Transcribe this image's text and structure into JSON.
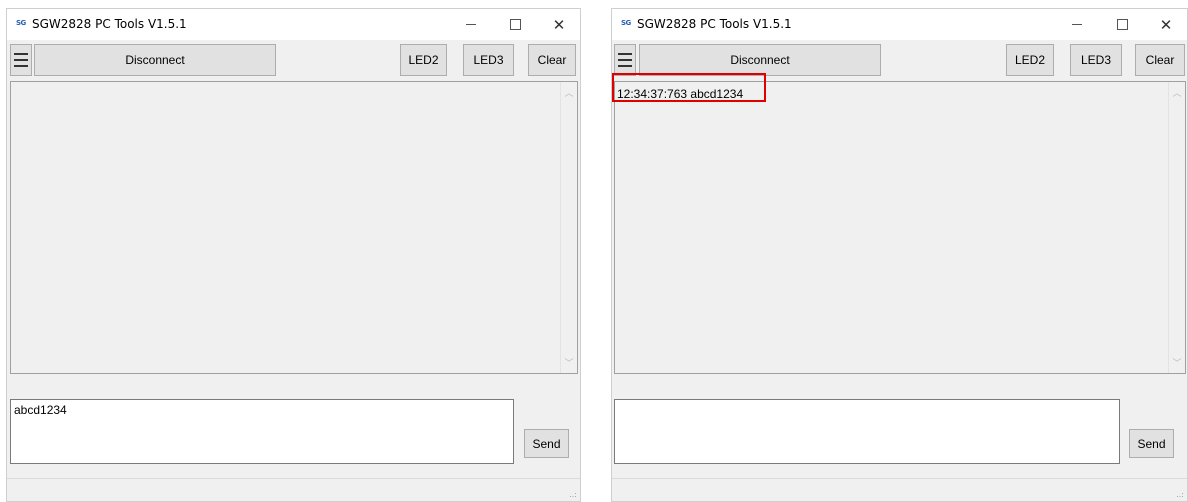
{
  "left_window": {
    "title": "SGW2828 PC Tools V1.5.1",
    "app_icon_text": "SG",
    "toolbar": {
      "disconnect_label": "Disconnect",
      "led2_label": "LED2",
      "led3_label": "LED3",
      "clear_label": "Clear"
    },
    "log_text": "",
    "input_value": "abcd1234",
    "send_label": "Send"
  },
  "right_window": {
    "title": "SGW2828 PC Tools V1.5.1",
    "app_icon_text": "SG",
    "toolbar": {
      "disconnect_label": "Disconnect",
      "led2_label": "LED2",
      "led3_label": "LED3",
      "clear_label": "Clear"
    },
    "log_text": "12:34:37:763 abcd1234",
    "input_value": "",
    "send_label": "Send"
  },
  "caption_glyphs": {
    "close": "✕"
  },
  "scroll_glyphs": {
    "up": "︿",
    "down": "﹀"
  },
  "grip_glyph": "..:",
  "highlight_color": "#e00000"
}
